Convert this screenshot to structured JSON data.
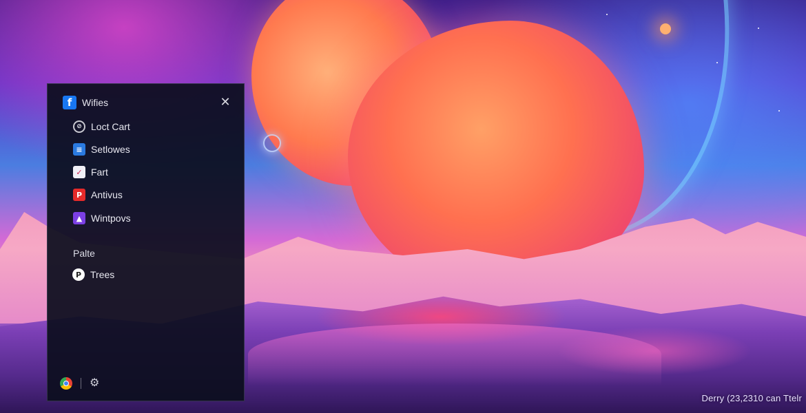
{
  "menu": {
    "header": {
      "icon": "facebook-icon",
      "title": "Wifies"
    },
    "close_icon": "close-icon",
    "items": [
      {
        "label": "Loct Cart",
        "icon": "lock-icon"
      },
      {
        "label": "Setlowes",
        "icon": "settings-icon"
      },
      {
        "label": "Fart",
        "icon": "fart-app-icon"
      },
      {
        "label": "Antivus",
        "icon": "antivirus-icon"
      },
      {
        "label": "Wintpovs",
        "icon": "windows-icon"
      }
    ],
    "section_label": "Palte",
    "section_items": [
      {
        "label": "Trees",
        "icon": "pinterest-icon"
      }
    ],
    "footer": {
      "left_icon": "chrome-icon",
      "right_icon": "gear-icon"
    }
  },
  "desktop": {
    "bottom_text": "Derry (23,2310 can Ttelr"
  },
  "colors": {
    "menu_bg": "#0c0e1e",
    "accent_blue": "#1877f2"
  }
}
